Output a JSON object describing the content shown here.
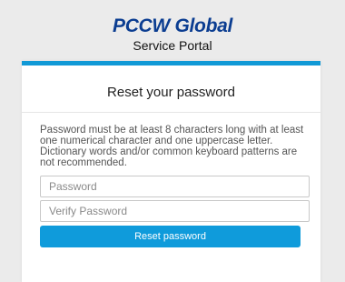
{
  "brand": {
    "logo_text": "PCCW Global",
    "portal_name": "Service Portal"
  },
  "reset_form": {
    "title": "Reset your password",
    "requirements": "Password must be at least 8 characters long with at least one numerical character and one uppercase letter. Dictionary words and/or common keyboard patterns are not recommended.",
    "password": {
      "value": "",
      "placeholder": "Password"
    },
    "verify_password": {
      "value": "",
      "placeholder": "Verify Password"
    },
    "submit_label": "Reset password"
  },
  "colors": {
    "accent": "#1199d6",
    "button": "#0f9bdb",
    "logo": "#0b3d91",
    "background": "#ebebeb"
  }
}
